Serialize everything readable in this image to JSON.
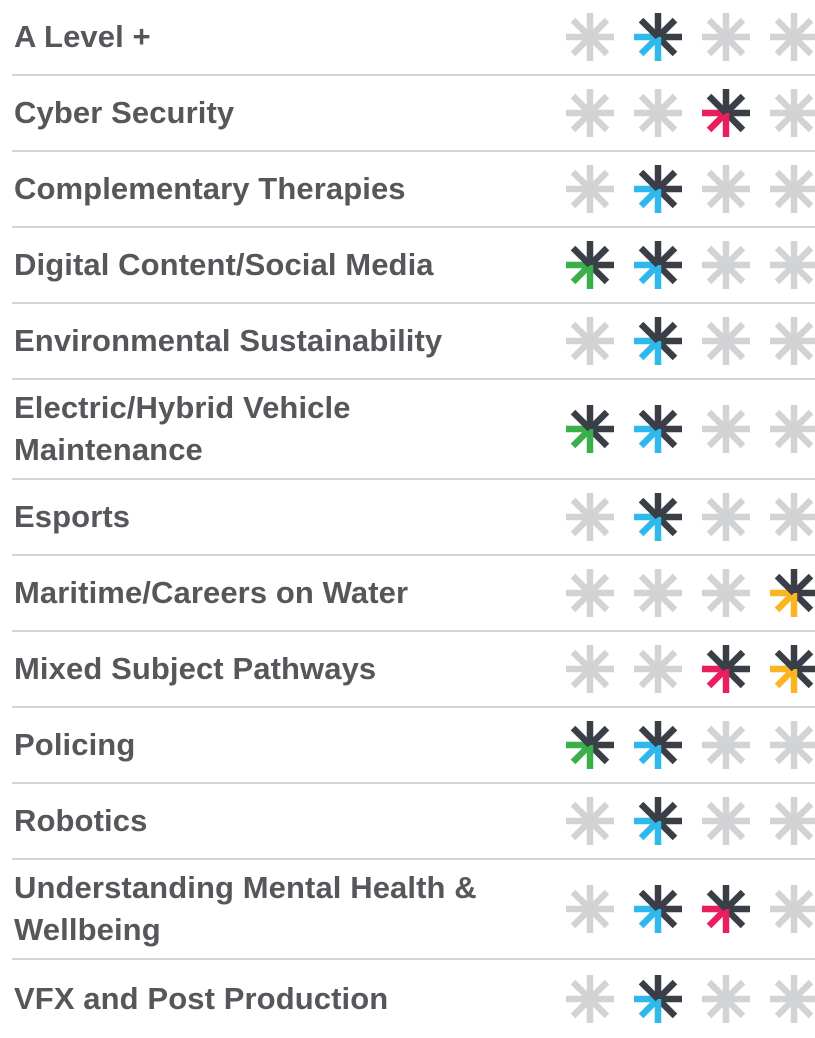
{
  "icons": {
    "inactive": "asterisk-inactive-icon",
    "active": "asterisk-active-icon"
  },
  "colors": {
    "inactive": "#d2d3d5",
    "dark": "#3a3f47",
    "green": "#3bb04a",
    "blue": "#2eb8ec",
    "pink": "#ea1e5f",
    "yellow": "#fbb522"
  },
  "columns": [
    "green",
    "blue",
    "pink",
    "yellow"
  ],
  "rows": [
    {
      "label": "A Level +",
      "active": [
        false,
        true,
        false,
        false
      ]
    },
    {
      "label": "Cyber Security",
      "active": [
        false,
        false,
        true,
        false
      ]
    },
    {
      "label": "Complementary Therapies",
      "active": [
        false,
        true,
        false,
        false
      ]
    },
    {
      "label": "Digital Content/Social Media",
      "active": [
        true,
        true,
        false,
        false
      ]
    },
    {
      "label": "Environmental Sustainability",
      "active": [
        false,
        true,
        false,
        false
      ]
    },
    {
      "label": "Electric/Hybrid Vehicle Maintenance",
      "active": [
        true,
        true,
        false,
        false
      ]
    },
    {
      "label": "Esports",
      "active": [
        false,
        true,
        false,
        false
      ]
    },
    {
      "label": "Maritime/Careers on Water",
      "active": [
        false,
        false,
        false,
        true
      ]
    },
    {
      "label": "Mixed Subject Pathways",
      "active": [
        false,
        false,
        true,
        true
      ]
    },
    {
      "label": "Policing",
      "active": [
        true,
        true,
        false,
        false
      ]
    },
    {
      "label": "Robotics",
      "active": [
        false,
        true,
        false,
        false
      ]
    },
    {
      "label": "Understanding Mental Health & Wellbeing",
      "active": [
        false,
        true,
        true,
        false
      ]
    },
    {
      "label": "VFX and Post Production",
      "active": [
        false,
        true,
        false,
        false
      ]
    }
  ]
}
